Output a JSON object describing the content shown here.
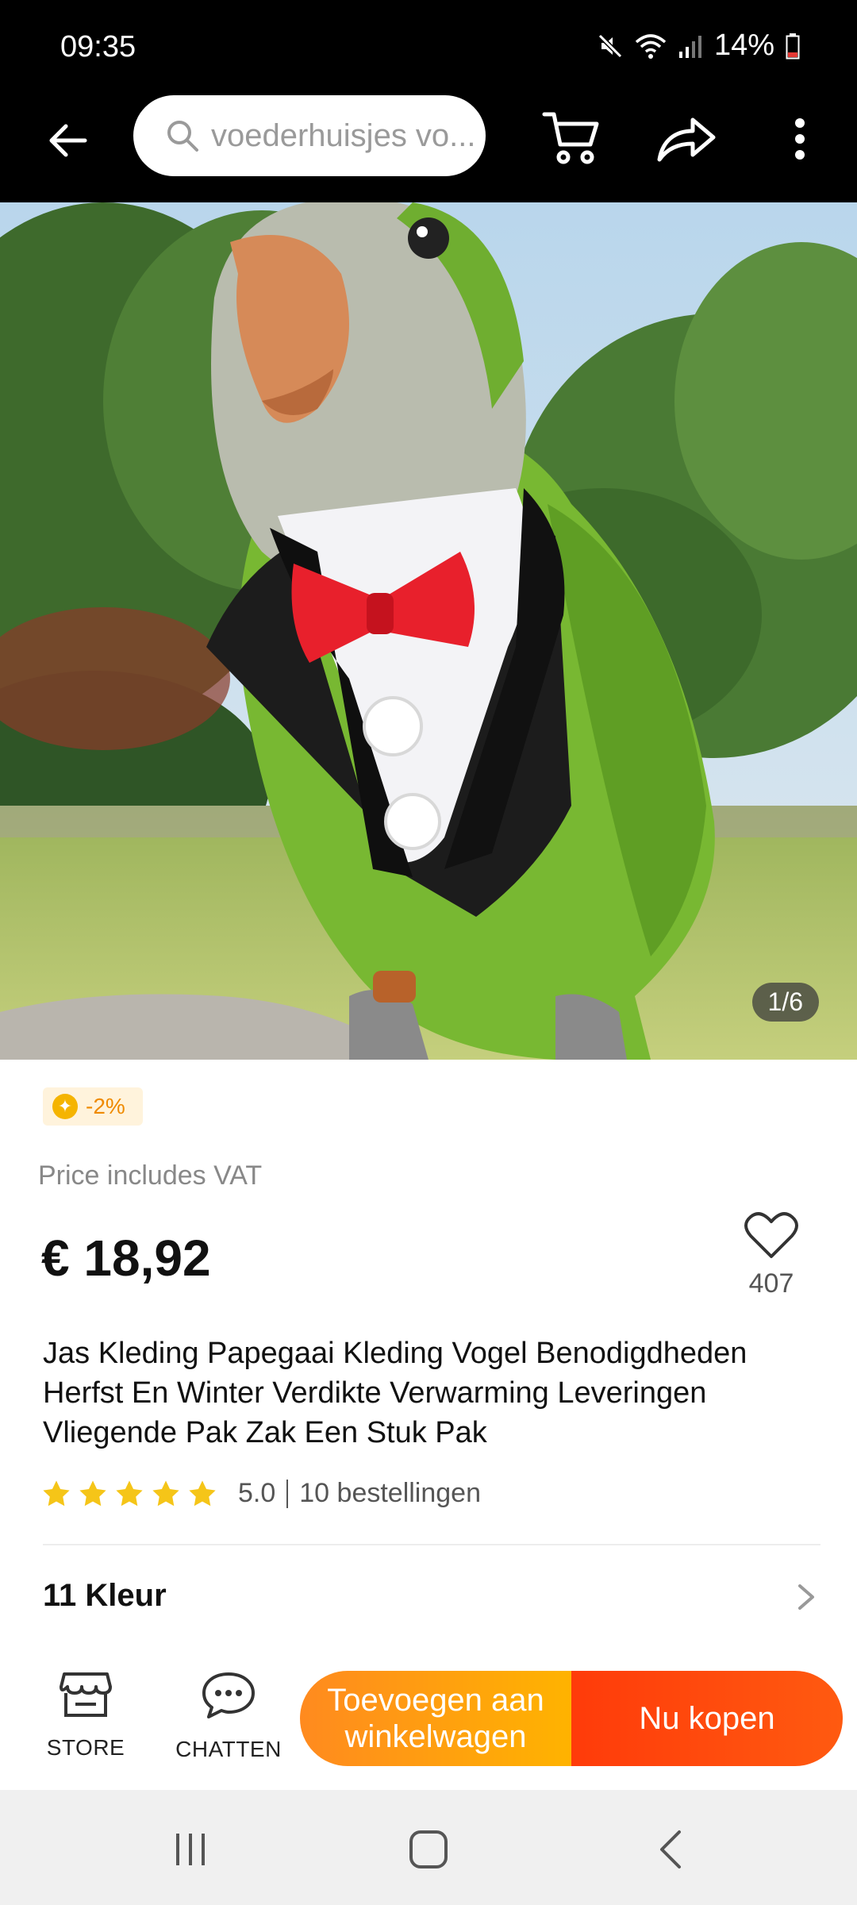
{
  "status_bar": {
    "time": "09:35",
    "battery": "14%",
    "icons": [
      "mute-icon",
      "wifi-icon",
      "signal-icon",
      "battery-icon"
    ]
  },
  "app_bar": {
    "search_placeholder": "voederhuisjes vo...",
    "icons": [
      "back-arrow-icon",
      "search-icon",
      "cart-icon",
      "share-icon",
      "more-vertical-icon"
    ]
  },
  "gallery": {
    "counter": "1/6"
  },
  "product": {
    "discount": "-2%",
    "vat_note": "Price includes VAT",
    "price": "€ 18,92",
    "wishlist_count": "407",
    "title": "Jas Kleding Papegaai Kleding Vogel Benodigdheden Herfst En Winter Verdikte Verwarming Leveringen Vliegende Pak Zak Een Stuk Pak",
    "rating": "5.0",
    "orders": "10 bestellingen",
    "stars": 5
  },
  "variant": {
    "label": "11 Kleur"
  },
  "actions": {
    "store_label": "STORE",
    "chat_label": "CHATTEN",
    "add_to_cart": "Toevoegen aan winkelwagen",
    "buy_now": "Nu kopen"
  },
  "colors": {
    "accent_orange": "#ff8a1f",
    "accent_red": "#ff3b0a",
    "star": "#f5c518"
  }
}
